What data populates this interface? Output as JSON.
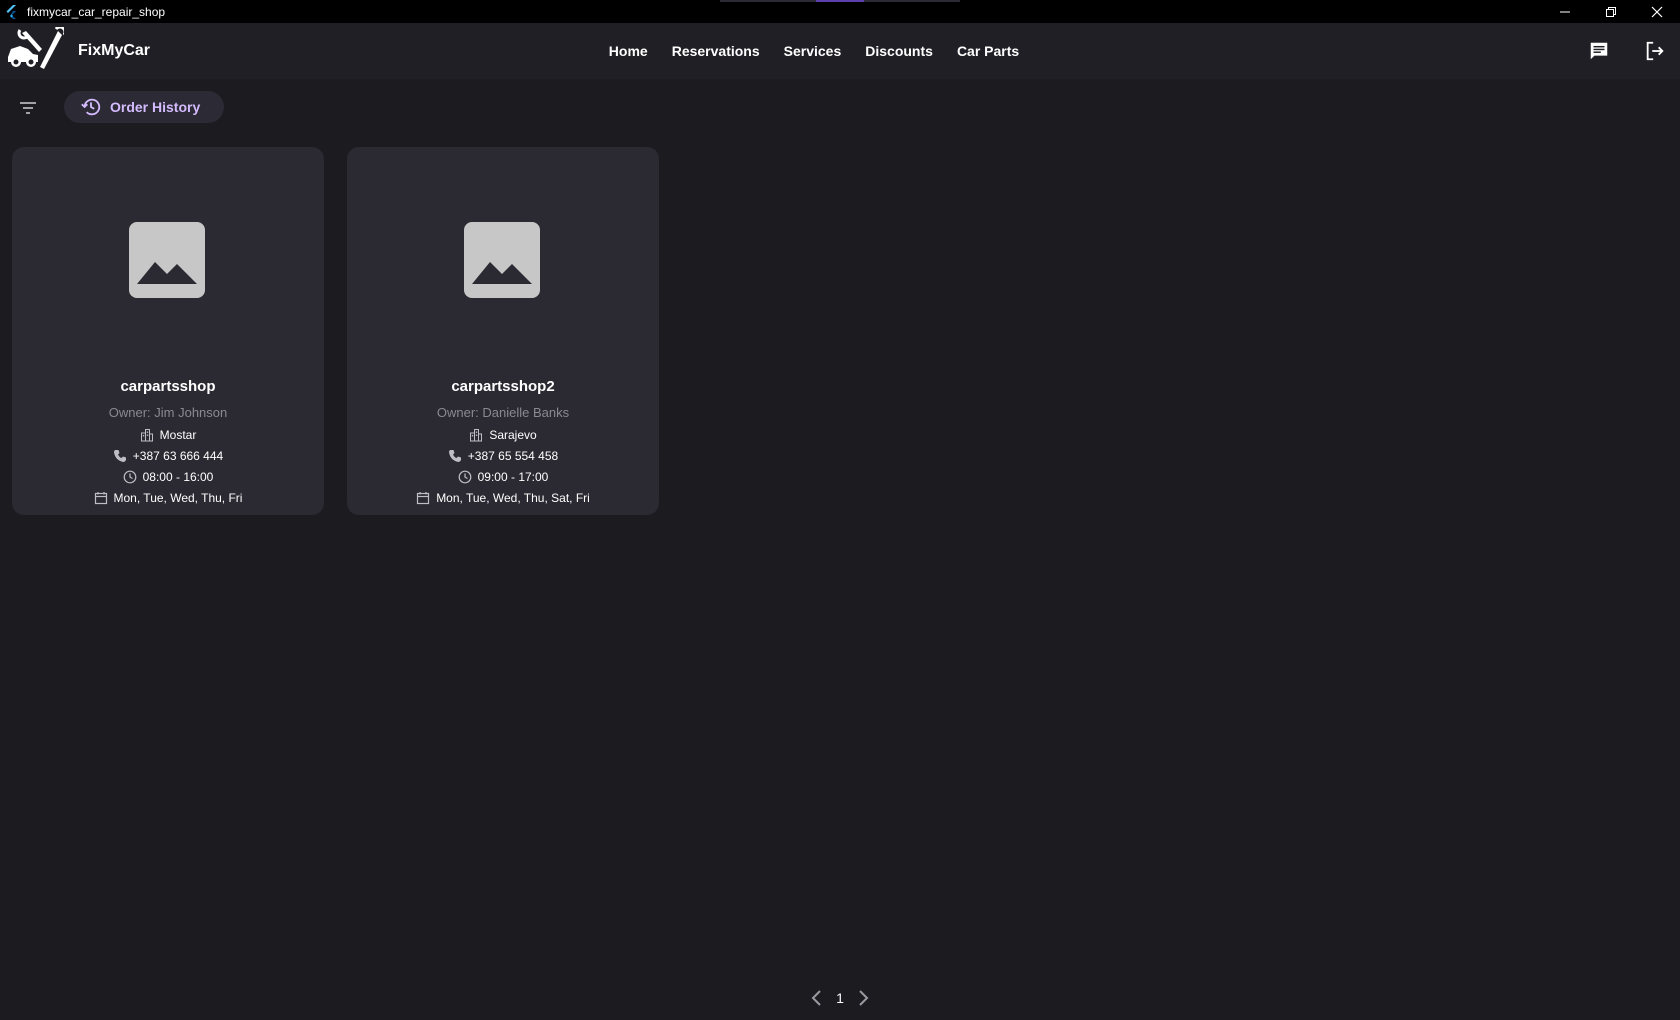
{
  "window": {
    "title": "fixmycar_car_repair_shop",
    "controls": [
      "minimize-icon",
      "restore-icon",
      "close-icon"
    ]
  },
  "appbar": {
    "brand": "FixMyCar",
    "logo_icon": "car-wrench-logo-icon",
    "nav": [
      {
        "label": "Home"
      },
      {
        "label": "Reservations"
      },
      {
        "label": "Services"
      },
      {
        "label": "Discounts"
      },
      {
        "label": "Car Parts"
      }
    ],
    "actions": [
      "chat-icon",
      "logout-icon"
    ]
  },
  "toolbar": {
    "filter_icon": "filter-icon",
    "order_history_label": "Order History",
    "order_history_icon": "history-icon"
  },
  "shops": [
    {
      "name": "carpartsshop",
      "owner": "Owner: Jim Johnson",
      "city": "Mostar",
      "phone": "+387 63 666 444",
      "hours": "08:00 - 16:00",
      "days": "Mon, Tue, Wed, Thu, Fri"
    },
    {
      "name": "carpartsshop2",
      "owner": "Owner: Danielle Banks",
      "city": "Sarajevo",
      "phone": "+387 65 554 458",
      "hours": "09:00 - 17:00",
      "days": "Mon, Tue, Wed, Thu, Sat, Fri"
    }
  ],
  "pagination": {
    "current_page": "1"
  },
  "colors": {
    "background": "#1c1b20",
    "appbar": "#211f26",
    "card": "#2b2a32",
    "accent": "#d4bbff",
    "muted_text": "#8a8891"
  }
}
